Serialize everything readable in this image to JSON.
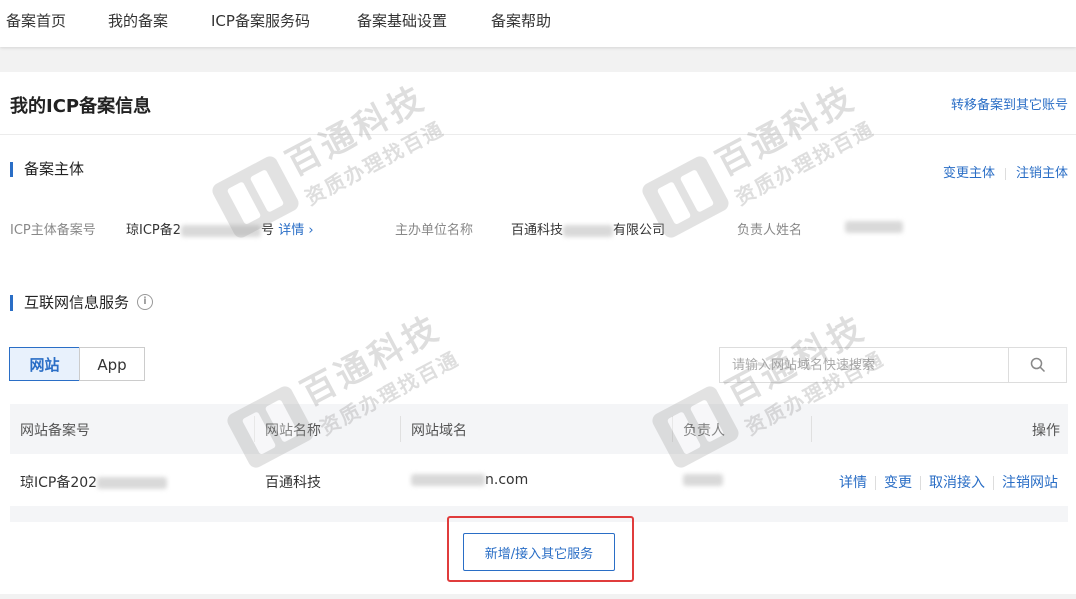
{
  "nav": {
    "items": [
      "备案首页",
      "我的备案",
      "ICP备案服务码",
      "备案基础设置",
      "备案帮助"
    ]
  },
  "page": {
    "title": "我的ICP备案信息",
    "transfer_link": "转移备案到其它账号"
  },
  "subject": {
    "heading": "备案主体",
    "change_label": "变更主体",
    "cancel_label": "注销主体",
    "icp_label": "ICP主体备案号",
    "icp_value_prefix": "琼ICP备2",
    "icp_value_suffix": "号",
    "detail_link": "详情 ›",
    "org_label": "主办单位名称",
    "org_value_prefix": "百通科技",
    "org_value_suffix": "有限公司",
    "owner_label": "负责人姓名"
  },
  "internet_service": {
    "heading": "互联网信息服务",
    "info_icon": "info-icon",
    "tabs": [
      "网站",
      "App"
    ],
    "active_tab": "网站",
    "search_placeholder": "请输入网站域名快速搜索"
  },
  "table": {
    "headers": [
      "网站备案号",
      "网站名称",
      "网站域名",
      "负责人",
      "操作"
    ],
    "rows": [
      {
        "record_prefix": "琼ICP备202",
        "name": "百通科技",
        "domain_suffix": "n.com",
        "actions": [
          "详情",
          "变更",
          "取消接入",
          "注销网站"
        ]
      }
    ]
  },
  "add_button": "新增/接入其它服务",
  "watermark": {
    "line1": "百通科技",
    "line2": "资质办理找百通"
  },
  "colors": {
    "accent": "#2a6ec6",
    "highlight": "#e03c3c"
  }
}
